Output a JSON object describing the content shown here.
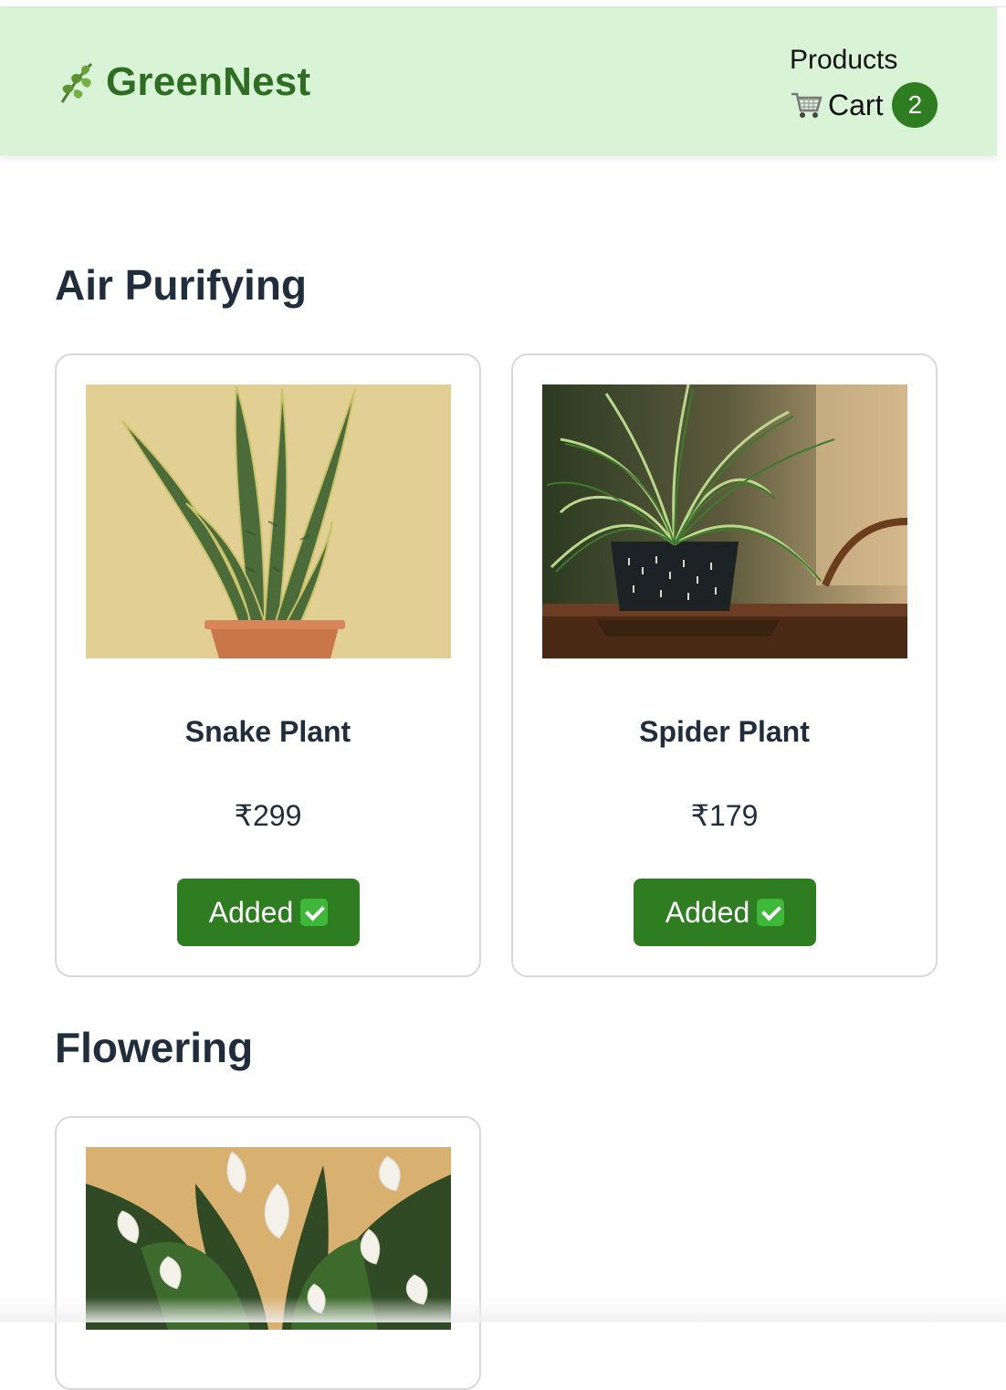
{
  "header": {
    "brand": "GreenNest",
    "brand_icon": "herb-leaf-icon",
    "nav_products": "Products",
    "nav_cart": "Cart",
    "cart_icon": "shopping-cart-icon",
    "cart_count": "2",
    "background": "#d9f3d6",
    "brand_color": "#2e6e22",
    "badge_color": "#2e7d20"
  },
  "sections": [
    {
      "title": "Air Purifying",
      "products": [
        {
          "name": "Snake Plant",
          "price": "₹299",
          "button": "Added",
          "image": "snake-plant-photo"
        },
        {
          "name": "Spider Plant",
          "price": "₹179",
          "button": "Added",
          "image": "spider-plant-photo"
        }
      ]
    },
    {
      "title": "Flowering",
      "products": [
        {
          "image": "peace-lily-photo"
        }
      ]
    }
  ],
  "button_color": "#2e7d20"
}
